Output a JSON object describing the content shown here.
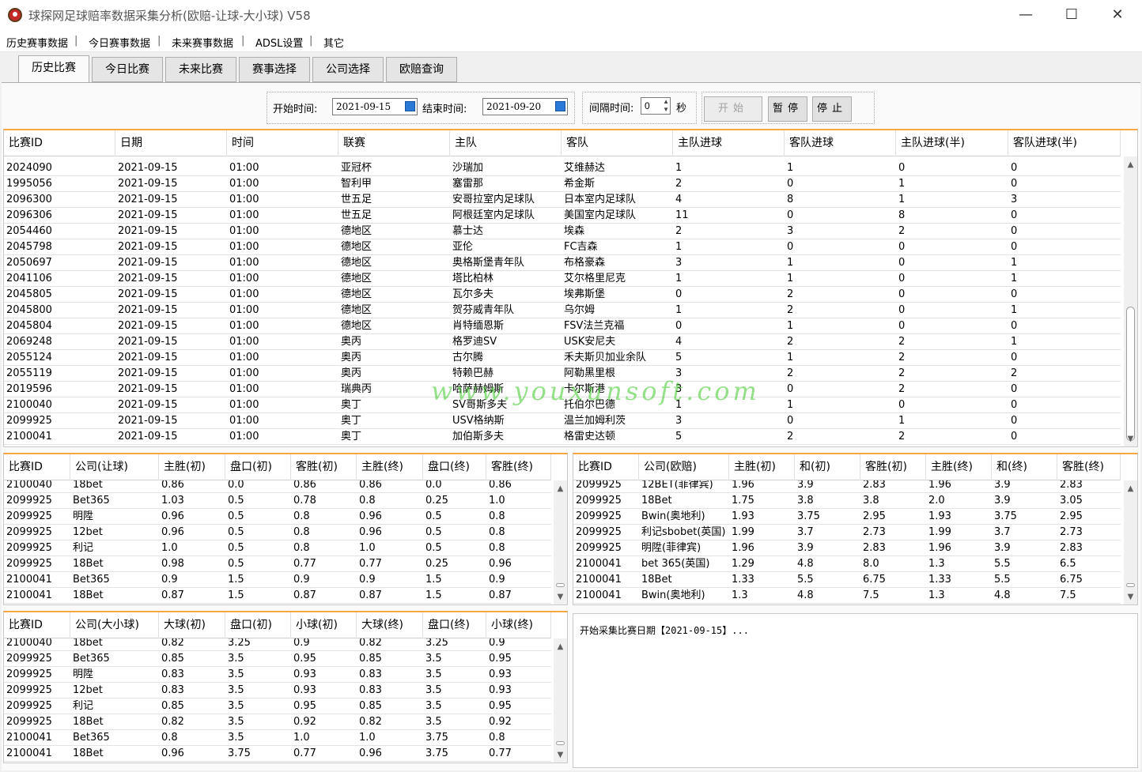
{
  "window": {
    "title": "球探网足球赔率数据采集分析(欧赔-让球-大小球) V58",
    "minimize": "—",
    "maximize": "☐",
    "close": "✕"
  },
  "menu": [
    "历史赛事数据",
    "今日赛事数据",
    "未来赛事数据",
    "ADSL设置",
    "其它"
  ],
  "tabs": [
    "历史比赛",
    "今日比赛",
    "未来比赛",
    "赛事选择",
    "公司选择",
    "欧赔查询"
  ],
  "controls": {
    "start_label": "开始时间:",
    "start_value": "2021-09-15",
    "end_label": "结束时间:",
    "end_value": "2021-09-20",
    "interval_label": "间隔时间:",
    "interval_value": "0",
    "interval_unit": "秒",
    "start_btn": "开始",
    "pause_btn": "暂停",
    "stop_btn": "停止"
  },
  "match_grid": {
    "columns": [
      "比赛ID",
      "日期",
      "时间",
      "联赛",
      "主队",
      "客队",
      "主队进球",
      "客队进球",
      "主队进球(半)",
      "客队进球(半)"
    ],
    "rows": [
      [
        "2024090",
        "2021-09-15",
        "01:00",
        "亚冠杯",
        "沙瑞加",
        "艾维赫达",
        "1",
        "1",
        "0",
        "0"
      ],
      [
        "1995056",
        "2021-09-15",
        "01:00",
        "智利甲",
        "塞雷那",
        "希金斯",
        "2",
        "0",
        "1",
        "0"
      ],
      [
        "2096300",
        "2021-09-15",
        "01:00",
        "世五足",
        "安哥拉室内足球队",
        "日本室内足球队",
        "4",
        "8",
        "1",
        "3"
      ],
      [
        "2096306",
        "2021-09-15",
        "01:00",
        "世五足",
        "阿根廷室内足球队",
        "美国室内足球队",
        "11",
        "0",
        "8",
        "0"
      ],
      [
        "2054460",
        "2021-09-15",
        "01:00",
        "德地区",
        "慕士达",
        "埃森",
        "2",
        "3",
        "2",
        "0"
      ],
      [
        "2045798",
        "2021-09-15",
        "01:00",
        "德地区",
        "亚伦",
        "FC吉森",
        "1",
        "0",
        "0",
        "0"
      ],
      [
        "2050697",
        "2021-09-15",
        "01:00",
        "德地区",
        "奥格斯堡青年队",
        "布格豪森",
        "3",
        "1",
        "0",
        "1"
      ],
      [
        "2041106",
        "2021-09-15",
        "01:00",
        "德地区",
        "塔比柏林",
        "艾尔格里尼克",
        "1",
        "1",
        "0",
        "1"
      ],
      [
        "2045805",
        "2021-09-15",
        "01:00",
        "德地区",
        "瓦尔多夫",
        "埃弗斯堡",
        "0",
        "2",
        "0",
        "0"
      ],
      [
        "2045800",
        "2021-09-15",
        "01:00",
        "德地区",
        "贺芬威青年队",
        "乌尔姆",
        "1",
        "2",
        "0",
        "1"
      ],
      [
        "2045804",
        "2021-09-15",
        "01:00",
        "德地区",
        "肖特缅恩斯",
        "FSV法兰克福",
        "0",
        "1",
        "0",
        "0"
      ],
      [
        "2069248",
        "2021-09-15",
        "01:00",
        "奥丙",
        "格罗迪SV",
        "USK安尼夫",
        "4",
        "2",
        "2",
        "1"
      ],
      [
        "2055124",
        "2021-09-15",
        "01:00",
        "奥丙",
        "古尔腾",
        "禾夫斯贝加业余队",
        "5",
        "1",
        "2",
        "0"
      ],
      [
        "2055119",
        "2021-09-15",
        "01:00",
        "奥丙",
        "特赖巴赫",
        "阿勒黑里根",
        "3",
        "2",
        "2",
        "2"
      ],
      [
        "2019596",
        "2021-09-15",
        "01:00",
        "瑞典丙",
        "哈萨赫姆斯",
        "卡尔斯港",
        "3",
        "0",
        "2",
        "0"
      ],
      [
        "2100040",
        "2021-09-15",
        "01:00",
        "奥丁",
        "SV哥斯多夫",
        "托伯尔巴德",
        "1",
        "1",
        "0",
        "0"
      ],
      [
        "2099925",
        "2021-09-15",
        "01:00",
        "奥丁",
        "USV格纳斯",
        "温兰加姆利茨",
        "3",
        "0",
        "1",
        "0"
      ],
      [
        "2100041",
        "2021-09-15",
        "01:00",
        "奥丁",
        "加伯斯多夫",
        "格雷史达顿",
        "5",
        "2",
        "2",
        "0"
      ]
    ]
  },
  "handicap_grid": {
    "columns": [
      "比赛ID",
      "公司(让球)",
      "主胜(初)",
      "盘口(初)",
      "客胜(初)",
      "主胜(终)",
      "盘口(终)",
      "客胜(终)"
    ],
    "rows": [
      [
        "2100040",
        "18bet",
        "0.86",
        "0.0",
        "0.86",
        "0.86",
        "0.0",
        "0.86"
      ],
      [
        "2099925",
        "Bet365",
        "1.03",
        "0.5",
        "0.78",
        "0.8",
        "0.25",
        "1.0"
      ],
      [
        "2099925",
        "明陞",
        "0.96",
        "0.5",
        "0.8",
        "0.96",
        "0.5",
        "0.8"
      ],
      [
        "2099925",
        "12bet",
        "0.96",
        "0.5",
        "0.8",
        "0.96",
        "0.5",
        "0.8"
      ],
      [
        "2099925",
        "利记",
        "1.0",
        "0.5",
        "0.8",
        "1.0",
        "0.5",
        "0.8"
      ],
      [
        "2099925",
        "18Bet",
        "0.98",
        "0.5",
        "0.77",
        "0.77",
        "0.25",
        "0.96"
      ],
      [
        "2100041",
        "Bet365",
        "0.9",
        "1.5",
        "0.9",
        "0.9",
        "1.5",
        "0.9"
      ],
      [
        "2100041",
        "18Bet",
        "0.87",
        "1.5",
        "0.87",
        "0.87",
        "1.5",
        "0.87"
      ]
    ]
  },
  "euro_grid": {
    "columns": [
      "比赛ID",
      "公司(欧赔)",
      "主胜(初)",
      "和(初)",
      "客胜(初)",
      "主胜(终)",
      "和(终)",
      "客胜(终)"
    ],
    "rows": [
      [
        "2099925",
        "12BET(菲律宾)",
        "1.96",
        "3.9",
        "2.83",
        "1.96",
        "3.9",
        "2.83"
      ],
      [
        "2099925",
        "18Bet",
        "1.75",
        "3.8",
        "3.8",
        "2.0",
        "3.9",
        "3.05"
      ],
      [
        "2099925",
        "Bwin(奥地利)",
        "1.93",
        "3.75",
        "2.95",
        "1.93",
        "3.75",
        "2.95"
      ],
      [
        "2099925",
        "利记sbobet(英国)",
        "1.99",
        "3.7",
        "2.73",
        "1.99",
        "3.7",
        "2.73"
      ],
      [
        "2099925",
        "明陞(菲律宾)",
        "1.96",
        "3.9",
        "2.83",
        "1.96",
        "3.9",
        "2.83"
      ],
      [
        "2100041",
        "bet 365(英国)",
        "1.29",
        "4.8",
        "8.0",
        "1.3",
        "5.5",
        "6.5"
      ],
      [
        "2100041",
        "18Bet",
        "1.33",
        "5.5",
        "6.75",
        "1.33",
        "5.5",
        "6.75"
      ],
      [
        "2100041",
        "Bwin(奥地利)",
        "1.3",
        "4.8",
        "7.5",
        "1.3",
        "4.8",
        "7.5"
      ]
    ]
  },
  "ou_grid": {
    "columns": [
      "比赛ID",
      "公司(大小球)",
      "大球(初)",
      "盘口(初)",
      "小球(初)",
      "大球(终)",
      "盘口(终)",
      "小球(终)"
    ],
    "rows": [
      [
        "2100040",
        "18bet",
        "0.82",
        "3.25",
        "0.9",
        "0.82",
        "3.25",
        "0.9"
      ],
      [
        "2099925",
        "Bet365",
        "0.85",
        "3.5",
        "0.95",
        "0.85",
        "3.5",
        "0.95"
      ],
      [
        "2099925",
        "明陞",
        "0.83",
        "3.5",
        "0.93",
        "0.83",
        "3.5",
        "0.93"
      ],
      [
        "2099925",
        "12bet",
        "0.83",
        "3.5",
        "0.93",
        "0.83",
        "3.5",
        "0.93"
      ],
      [
        "2099925",
        "利记",
        "0.85",
        "3.5",
        "0.95",
        "0.85",
        "3.5",
        "0.95"
      ],
      [
        "2099925",
        "18Bet",
        "0.82",
        "3.5",
        "0.92",
        "0.82",
        "3.5",
        "0.92"
      ],
      [
        "2100041",
        "Bet365",
        "0.8",
        "3.5",
        "1.0",
        "1.0",
        "3.75",
        "0.8"
      ],
      [
        "2100041",
        "18Bet",
        "0.96",
        "3.75",
        "0.77",
        "0.96",
        "3.75",
        "0.77"
      ]
    ]
  },
  "log": {
    "text": "开始采集比赛日期【2021-09-15】..."
  },
  "watermark": "www.youxunsoft.com"
}
